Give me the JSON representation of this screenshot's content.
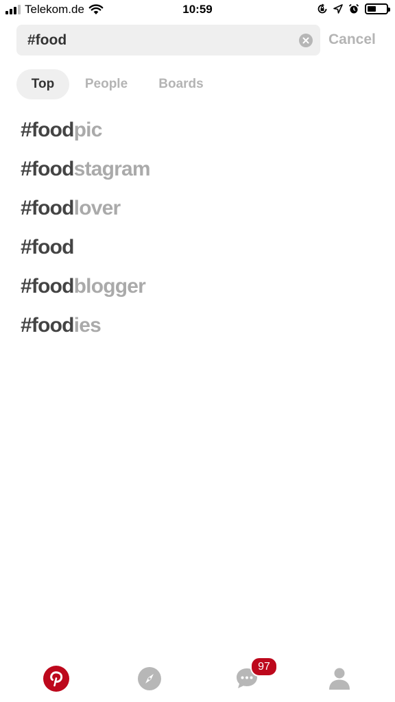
{
  "status_bar": {
    "carrier": "Telekom.de",
    "time": "10:59",
    "icons": [
      "signal-icon",
      "wifi-icon",
      "orientation-lock-icon",
      "location-icon",
      "alarm-icon",
      "battery-icon"
    ]
  },
  "search": {
    "value": "#food",
    "cancel_label": "Cancel"
  },
  "tabs": [
    {
      "label": "Top",
      "active": true
    },
    {
      "label": "People",
      "active": false
    },
    {
      "label": "Boards",
      "active": false
    }
  ],
  "suggestions": [
    {
      "query": "#food",
      "rest": "pic"
    },
    {
      "query": "#food",
      "rest": "stagram"
    },
    {
      "query": "#food",
      "rest": "lover"
    },
    {
      "query": "#food",
      "rest": ""
    },
    {
      "query": "#food",
      "rest": "blogger"
    },
    {
      "query": "#food",
      "rest": "ies"
    }
  ],
  "bottom_nav": {
    "items": [
      "pinterest-home-icon",
      "explore-compass-icon",
      "messages-icon",
      "profile-icon"
    ],
    "messages_badge": "97"
  },
  "colors": {
    "brand_red": "#bd081c",
    "inactive_gray": "#b4b4b4",
    "field_bg": "#efefef"
  }
}
